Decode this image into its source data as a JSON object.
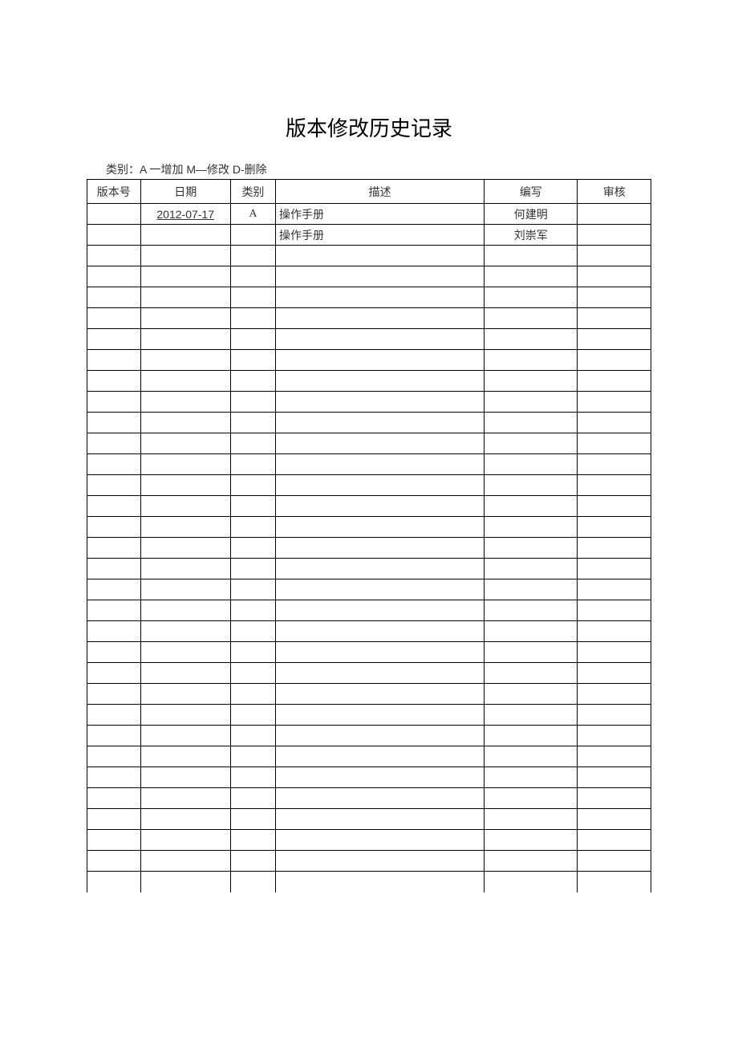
{
  "title": "版本修改历史记录",
  "legend": "类别：A 一增加 M—修改 D-删除",
  "headers": {
    "version": "版本号",
    "date": "日期",
    "category": "类别",
    "description": "描述",
    "author": "编写",
    "reviewer": "审核"
  },
  "rows": [
    {
      "version": "",
      "date": "2012-07-17",
      "category": "A",
      "description": "操作手册",
      "author": "何建明",
      "reviewer": ""
    },
    {
      "version": "",
      "date": "",
      "category": "",
      "description": "操作手册",
      "author": "刘崇军",
      "reviewer": ""
    },
    {
      "version": "",
      "date": "",
      "category": "",
      "description": "",
      "author": "",
      "reviewer": ""
    },
    {
      "version": "",
      "date": "",
      "category": "",
      "description": "",
      "author": "",
      "reviewer": ""
    },
    {
      "version": "",
      "date": "",
      "category": "",
      "description": "",
      "author": "",
      "reviewer": ""
    },
    {
      "version": "",
      "date": "",
      "category": "",
      "description": "",
      "author": "",
      "reviewer": ""
    },
    {
      "version": "",
      "date": "",
      "category": "",
      "description": "",
      "author": "",
      "reviewer": ""
    },
    {
      "version": "",
      "date": "",
      "category": "",
      "description": "",
      "author": "",
      "reviewer": ""
    },
    {
      "version": "",
      "date": "",
      "category": "",
      "description": "",
      "author": "",
      "reviewer": ""
    },
    {
      "version": "",
      "date": "",
      "category": "",
      "description": "",
      "author": "",
      "reviewer": ""
    },
    {
      "version": "",
      "date": "",
      "category": "",
      "description": "",
      "author": "",
      "reviewer": ""
    },
    {
      "version": "",
      "date": "",
      "category": "",
      "description": "",
      "author": "",
      "reviewer": ""
    },
    {
      "version": "",
      "date": "",
      "category": "",
      "description": "",
      "author": "",
      "reviewer": ""
    },
    {
      "version": "",
      "date": "",
      "category": "",
      "description": "",
      "author": "",
      "reviewer": ""
    },
    {
      "version": "",
      "date": "",
      "category": "",
      "description": "",
      "author": "",
      "reviewer": ""
    },
    {
      "version": "",
      "date": "",
      "category": "",
      "description": "",
      "author": "",
      "reviewer": ""
    },
    {
      "version": "",
      "date": "",
      "category": "",
      "description": "",
      "author": "",
      "reviewer": ""
    },
    {
      "version": "",
      "date": "",
      "category": "",
      "description": "",
      "author": "",
      "reviewer": ""
    },
    {
      "version": "",
      "date": "",
      "category": "",
      "description": "",
      "author": "",
      "reviewer": ""
    },
    {
      "version": "",
      "date": "",
      "category": "",
      "description": "",
      "author": "",
      "reviewer": ""
    },
    {
      "version": "",
      "date": "",
      "category": "",
      "description": "",
      "author": "",
      "reviewer": ""
    },
    {
      "version": "",
      "date": "",
      "category": "",
      "description": "",
      "author": "",
      "reviewer": ""
    },
    {
      "version": "",
      "date": "",
      "category": "",
      "description": "",
      "author": "",
      "reviewer": ""
    },
    {
      "version": "",
      "date": "",
      "category": "",
      "description": "",
      "author": "",
      "reviewer": ""
    },
    {
      "version": "",
      "date": "",
      "category": "",
      "description": "",
      "author": "",
      "reviewer": ""
    },
    {
      "version": "",
      "date": "",
      "category": "",
      "description": "",
      "author": "",
      "reviewer": ""
    },
    {
      "version": "",
      "date": "",
      "category": "",
      "description": "",
      "author": "",
      "reviewer": ""
    },
    {
      "version": "",
      "date": "",
      "category": "",
      "description": "",
      "author": "",
      "reviewer": ""
    },
    {
      "version": "",
      "date": "",
      "category": "",
      "description": "",
      "author": "",
      "reviewer": ""
    },
    {
      "version": "",
      "date": "",
      "category": "",
      "description": "",
      "author": "",
      "reviewer": ""
    },
    {
      "version": "",
      "date": "",
      "category": "",
      "description": "",
      "author": "",
      "reviewer": ""
    },
    {
      "version": "",
      "date": "",
      "category": "",
      "description": "",
      "author": "",
      "reviewer": ""
    },
    {
      "version": "",
      "date": "",
      "category": "",
      "description": "",
      "author": "",
      "reviewer": ""
    }
  ]
}
